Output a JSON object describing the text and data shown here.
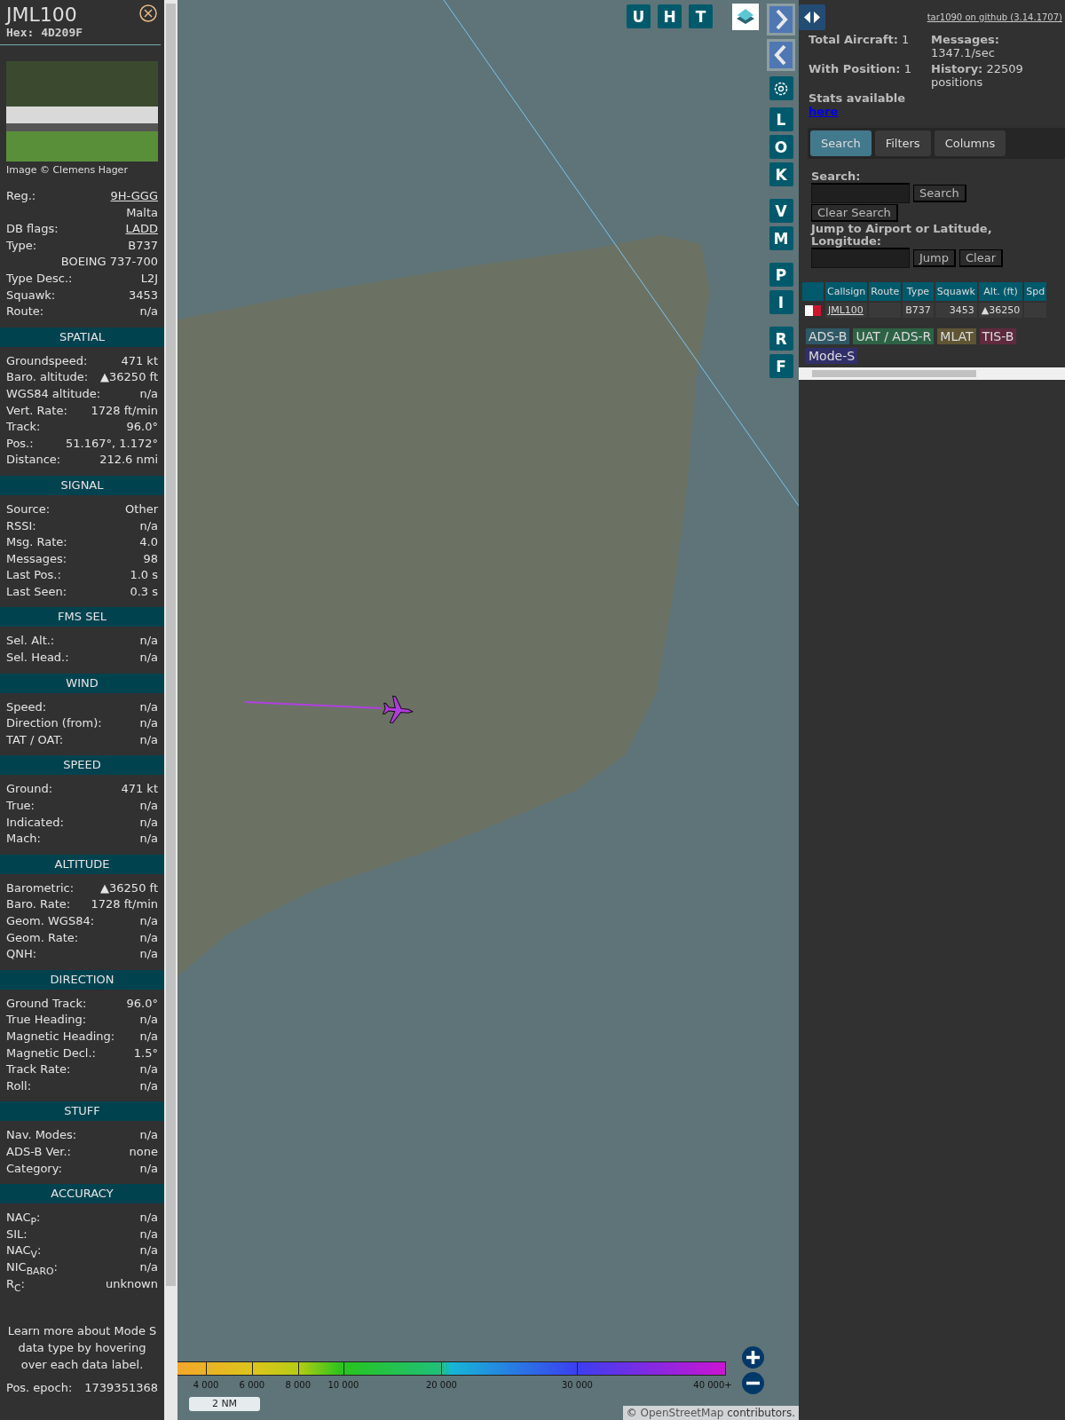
{
  "aircraft_panel": {
    "callsign": "JML100",
    "hex": "Hex: 4D209F",
    "photo_credit": "Image © Clemens Hager",
    "details": [
      {
        "label": "Reg.:",
        "value": "9H-GGG",
        "link": true
      },
      {
        "value": "Malta",
        "link": false
      },
      {
        "label": "DB flags:",
        "value": "LADD",
        "link": true
      },
      {
        "label": "Type:",
        "value": "B737",
        "link": false
      },
      {
        "value": "BOEING 737-700",
        "link": false
      },
      {
        "label": "Type Desc.:",
        "value": "L2J",
        "link": false
      },
      {
        "label": "Squawk:",
        "value": "3453",
        "link": false
      },
      {
        "label": "Route:",
        "value": "n/a",
        "link": false
      }
    ],
    "sections": [
      {
        "title": "SPATIAL",
        "rows": [
          {
            "label": "Groundspeed:",
            "value": "471 kt"
          },
          {
            "label": "Baro. altitude:",
            "value": "▲36250 ft"
          },
          {
            "label": "WGS84 altitude:",
            "value": "n/a"
          },
          {
            "label": "Vert. Rate:",
            "value": "1728 ft/min"
          },
          {
            "label": "Track:",
            "value": "96.0°"
          },
          {
            "label": "Pos.:",
            "value": "51.167°, 1.172°"
          },
          {
            "label": "Distance:",
            "value": "212.6 nmi"
          }
        ]
      },
      {
        "title": "SIGNAL",
        "rows": [
          {
            "label": "Source:",
            "value": "Other"
          },
          {
            "label": "RSSI:",
            "value": "n/a"
          },
          {
            "label": "Msg. Rate:",
            "value": "4.0"
          },
          {
            "label": "Messages:",
            "value": "98"
          },
          {
            "label": "Last Pos.:",
            "value": "1.0 s"
          },
          {
            "label": "Last Seen:",
            "value": "0.3 s"
          }
        ]
      },
      {
        "title": "FMS SEL",
        "rows": [
          {
            "label": "Sel. Alt.:",
            "value": "n/a"
          },
          {
            "label": "Sel. Head.:",
            "value": "n/a"
          }
        ]
      },
      {
        "title": "WIND",
        "rows": [
          {
            "label": "Speed:",
            "value": "n/a"
          },
          {
            "label": "Direction (from):",
            "value": "n/a"
          },
          {
            "label": "TAT / OAT:",
            "value": "n/a"
          }
        ]
      },
      {
        "title": "SPEED",
        "rows": [
          {
            "label": "Ground:",
            "value": "471 kt"
          },
          {
            "label": "True:",
            "value": "n/a"
          },
          {
            "label": "Indicated:",
            "value": "n/a"
          },
          {
            "label": "Mach:",
            "value": "n/a"
          }
        ]
      },
      {
        "title": "ALTITUDE",
        "rows": [
          {
            "label": "Barometric:",
            "value": "▲36250 ft"
          },
          {
            "label": "Baro. Rate:",
            "value": "1728 ft/min"
          },
          {
            "label": "Geom. WGS84:",
            "value": "n/a"
          },
          {
            "label": "Geom. Rate:",
            "value": "n/a"
          },
          {
            "label": "QNH:",
            "value": "n/a"
          }
        ]
      },
      {
        "title": "DIRECTION",
        "rows": [
          {
            "label": "Ground Track:",
            "value": "96.0°"
          },
          {
            "label": "True Heading:",
            "value": "n/a"
          },
          {
            "label": "Magnetic Heading:",
            "value": "n/a"
          },
          {
            "label": "Magnetic Decl.:",
            "value": "1.5°"
          },
          {
            "label": "Track Rate:",
            "value": "n/a"
          },
          {
            "label": "Roll:",
            "value": "n/a"
          }
        ]
      },
      {
        "title": "STUFF",
        "rows": [
          {
            "label": "Nav. Modes:",
            "value": "n/a"
          },
          {
            "label": "ADS-B Ver.:",
            "value": "none"
          },
          {
            "label": "Category:",
            "value": "n/a"
          }
        ]
      },
      {
        "title": "ACCURACY",
        "rows": [
          {
            "label": "NAC$_{P}$:",
            "value": "n/a"
          },
          {
            "label": "SIL:",
            "value": "n/a"
          },
          {
            "label": "NAC$_{V}$:",
            "value": "n/a"
          },
          {
            "label": "NIC$_{BARO}$:",
            "value": "n/a"
          },
          {
            "label": "R$_{C}$:",
            "value": "unknown"
          }
        ]
      }
    ],
    "footer_note": "Learn more about Mode S data type by hovering over each data label.",
    "epoch": {
      "label": "Pos. epoch:",
      "value": "1739351368"
    }
  },
  "map": {
    "top_buttons": [
      "U",
      "H",
      "T"
    ],
    "side_button_groups": [
      [
        "L",
        "O",
        "K"
      ],
      [
        "V",
        "M"
      ],
      [
        "P",
        "I"
      ],
      [
        "R",
        "F"
      ]
    ],
    "altitude_legend": [
      "4 000",
      "6 000",
      "8 000",
      "10 000",
      "20 000",
      "30 000",
      "40 000+"
    ],
    "scale": "2 NM",
    "attribution": {
      "prefix": "©",
      "link": "OpenStreetMap",
      "suffix": "contributors."
    }
  },
  "right_panel": {
    "github_link": "tar1090 on github (3.14.1707)",
    "stats": [
      "**Total Aircraft:** 1",
      "**Messages:** 1347.1/sec",
      "**With Position:** 1",
      "**History:** 22509 positions"
    ],
    "stats_label": "Stats available",
    "stats_link": "here",
    "tabs": [
      {
        "label": "Search",
        "selected": true
      },
      {
        "label": "Filters",
        "selected": false
      },
      {
        "label": "Columns",
        "selected": false
      }
    ],
    "search_label": "Search:",
    "search_button": "Search",
    "clear_search_button": "Clear Search",
    "jump_label": "Jump to Airport or Latitude, Longitude:",
    "jump_button": "Jump",
    "clear_button": "Clear",
    "table": {
      "columns": [
        "Callsign",
        "Route",
        "Type",
        "Squawk",
        "Alt. (ft)",
        "Spd"
      ],
      "rows": [
        {
          "callsign": "JML100",
          "route": "",
          "type": "B737",
          "squawk": "3453",
          "altitude": "▲36250"
        }
      ]
    },
    "legend": [
      {
        "label": "ADS-B",
        "color": "#2f5866"
      },
      {
        "label": "UAT / ADS-R",
        "color": "#2e6245"
      },
      {
        "label": "MLAT",
        "color": "#5f5535"
      },
      {
        "label": "TIS-B",
        "color": "#5e2a3e"
      },
      {
        "label": "Mode-S",
        "color": "#312f6a"
      }
    ]
  }
}
